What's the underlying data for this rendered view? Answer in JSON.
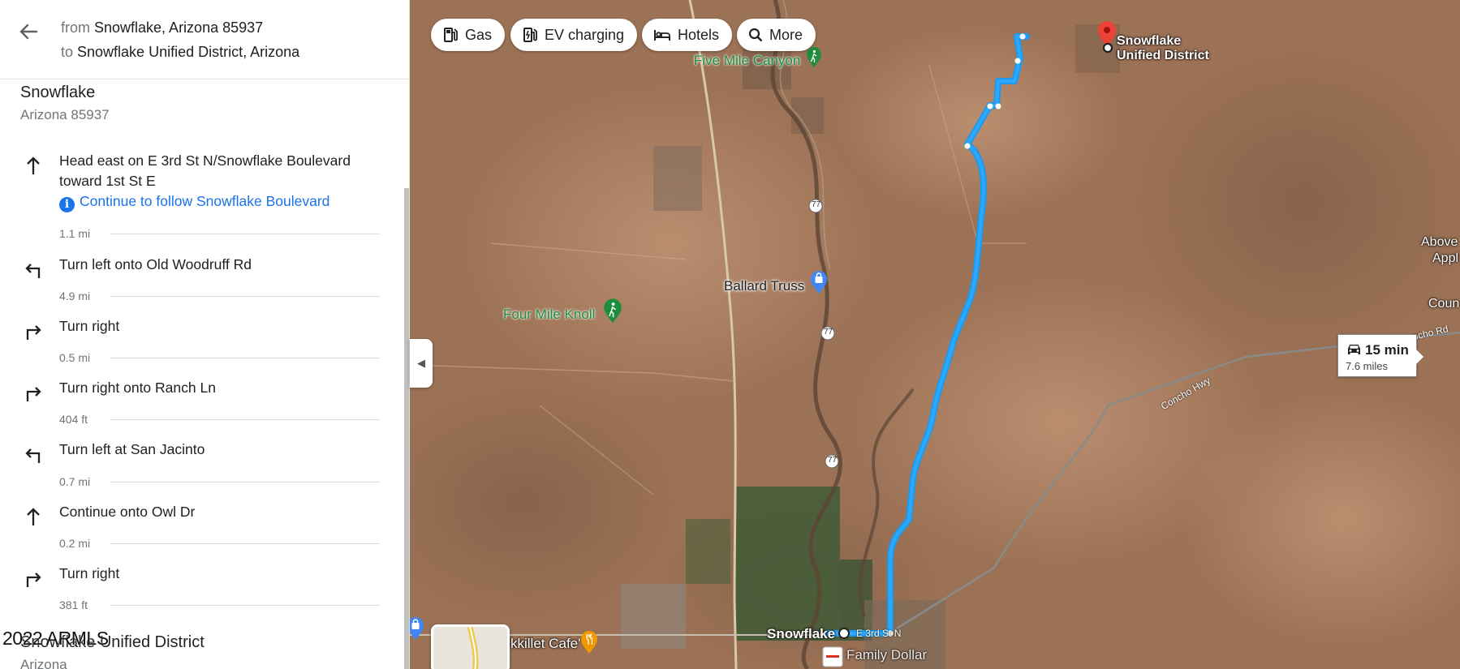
{
  "directions": {
    "from_prefix": "from",
    "from": "Snowflake, Arizona 85937",
    "to_prefix": "to",
    "to": "Snowflake Unified District, Arizona",
    "origin": {
      "name": "Snowflake",
      "sub": "Arizona 85937"
    },
    "steps": [
      {
        "icon": "arrow-up-icon",
        "text": "Head east on E 3rd St N/Snowflake Boulevard toward 1st St E",
        "note": "Continue to follow Snowflake Boulevard",
        "distance": "1.1 mi"
      },
      {
        "icon": "turn-left-icon",
        "text": "Turn left onto Old Woodruff Rd",
        "distance": "4.9 mi"
      },
      {
        "icon": "turn-right-icon",
        "text": "Turn right",
        "distance": "0.5 mi"
      },
      {
        "icon": "turn-right-icon",
        "text": "Turn right onto Ranch Ln",
        "distance": "404 ft"
      },
      {
        "icon": "turn-left-icon",
        "text": "Turn left at San Jacinto",
        "distance": "0.7 mi"
      },
      {
        "icon": "arrow-up-icon",
        "text": "Continue onto Owl Dr",
        "distance": "0.2 mi"
      },
      {
        "icon": "turn-right-icon",
        "text": "Turn right",
        "distance": "381 ft"
      }
    ],
    "destination": {
      "name": "Snowflake Unified District",
      "sub": "Arizona"
    },
    "watermark": "2022 ARMLS"
  },
  "map": {
    "chips": [
      {
        "label": "Gas",
        "icon": "gas-station-icon"
      },
      {
        "label": "EV charging",
        "icon": "ev-charging-icon"
      },
      {
        "label": "Hotels",
        "icon": "hotel-icon"
      },
      {
        "label": "More",
        "icon": "search-icon"
      }
    ],
    "route_summary": {
      "time": "15 min",
      "distance": "7.6 miles"
    },
    "labels": {
      "five_mile_canyon": "Five Mile Canyon",
      "ballard_truss": "Ballard Truss",
      "four_mile_knoll": "Four Mile Knoll",
      "dest_line1": "Snowflake",
      "dest_line2": "Unified District",
      "snowflake": "Snowflake",
      "e3rd": "E 3rd St N",
      "skillet": "kkillet Cafe'",
      "family_dollar": "Family Dollar",
      "concho_hwy": "Concho Hwy",
      "concho_rd": "Concho Rd",
      "above": "Above",
      "appl": "Appl",
      "coun": "Coun",
      "hwy77": "77"
    },
    "route_color": "#1a9bf0",
    "pin_color": "#ea4335"
  }
}
